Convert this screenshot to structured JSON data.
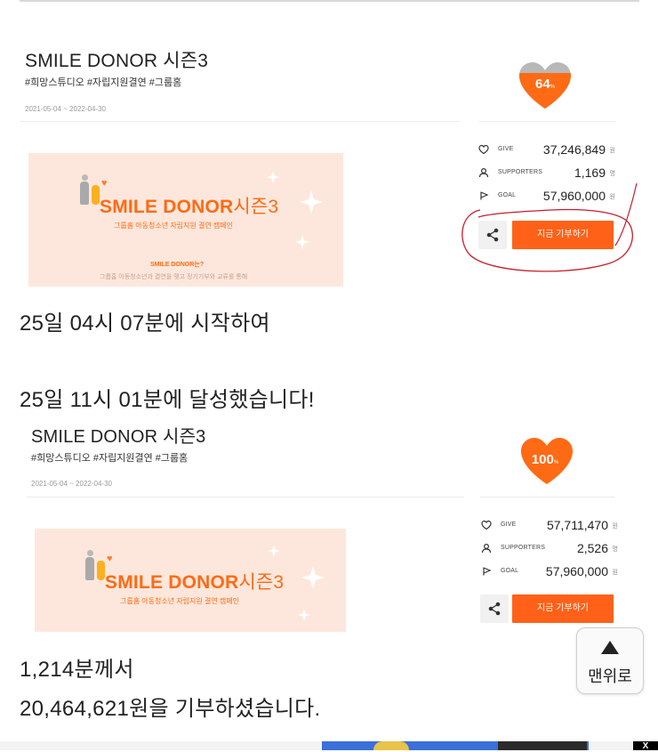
{
  "campaigns": [
    {
      "title": "SMILE DONOR 시즌3",
      "tags": "#희망스튜디오 #자립지원결연 #그룹홈",
      "dates": "2021-05-04 ~ 2022-04-30",
      "banner": {
        "logo_main": "SMILE DONOR",
        "logo_suffix": "시즌3",
        "subtitle": "그룹홈 아동청소년 자립지원 결연 캠페인",
        "small_title": "SMILE DONOR는?",
        "small_text": "그룹홈 아동청소년과 결연을 맺고 정기기부와 교류를 통해"
      },
      "progress": {
        "percent_value": 64,
        "label": "64",
        "unit": "%"
      },
      "stats": {
        "give": {
          "label": "GIVE",
          "value": "37,246,849",
          "unit": "원"
        },
        "supporters": {
          "label": "SUPPORTERS",
          "value": "1,169",
          "unit": "명"
        },
        "goal": {
          "label": "GOAL",
          "value": "57,960,000",
          "unit": "원"
        }
      },
      "donate_label": "지금 기부하기"
    },
    {
      "title": "SMILE DONOR 시즌3",
      "tags": "#희망스튜디오 #자립지원결연 #그룹홈",
      "dates": "2021-05-04 ~ 2022-04-30",
      "banner": {
        "logo_main": "SMILE DONOR",
        "logo_suffix": "시즌3",
        "subtitle": "그룹홈 아동청소년 자립지원 결연 캠페인"
      },
      "progress": {
        "percent_value": 100,
        "label": "100",
        "unit": "%"
      },
      "stats": {
        "give": {
          "label": "GIVE",
          "value": "57,711,470",
          "unit": "원"
        },
        "supporters": {
          "label": "SUPPORTERS",
          "value": "2,526",
          "unit": "명"
        },
        "goal": {
          "label": "GOAL",
          "value": "57,960,000",
          "unit": "원"
        }
      },
      "donate_label": "지금 기부하기"
    }
  ],
  "captions": {
    "line1": "25일 04시 07분에 시작하여",
    "line2": "25일 11시 01분에 달성했습니다!",
    "line3": "1,214분께서",
    "line4": "20,464,621원을 기부하셨습니다."
  },
  "scroll_top": {
    "label": "맨위로"
  },
  "ad_close": {
    "label": "X"
  },
  "colors": {
    "accent": "#ff6118",
    "heart": "#ff6a14",
    "heart_empty": "#b8b8b8",
    "annotation": "#c61d2c"
  }
}
